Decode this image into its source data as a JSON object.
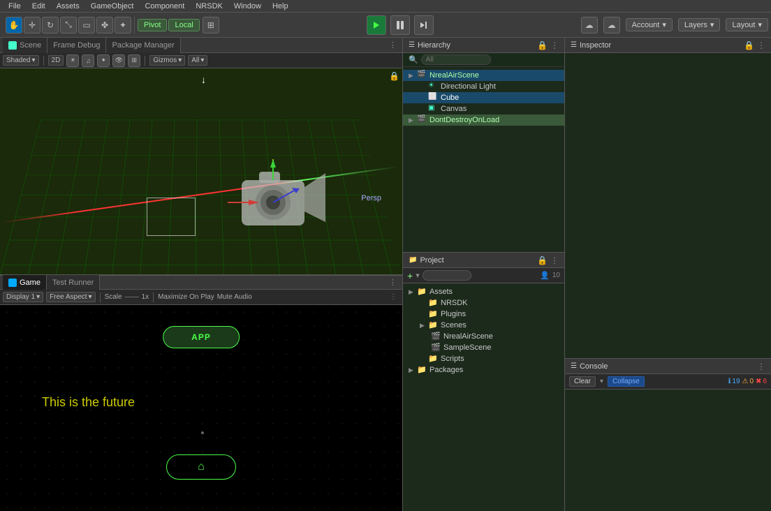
{
  "menubar": {
    "items": [
      "File",
      "Edit",
      "Assets",
      "GameObject",
      "Component",
      "NRSDK",
      "Window",
      "Help"
    ]
  },
  "toolbar": {
    "pivot_label": "Pivot",
    "local_label": "Local",
    "account_label": "Account",
    "layers_label": "Layers",
    "layout_label": "Layout"
  },
  "scene_tab": {
    "label": "Scene",
    "other_tabs": [
      "Frame Debug",
      "Package Manager"
    ],
    "shading_mode": "Shaded",
    "dim_mode": "2D",
    "gizmos_label": "Gizmos",
    "all_label": "All",
    "persp_label": "Persp"
  },
  "game_tab": {
    "label": "Game",
    "other_tabs": [
      "Test Runner"
    ],
    "display_label": "Display 1",
    "aspect_label": "Free Aspect",
    "scale_label": "Scale",
    "scale_value": "1x",
    "maximize_label": "Maximize On Play",
    "mute_label": "Mute Audio",
    "app_button_label": "APP",
    "game_text": "This is the future",
    "home_icon": "⌂"
  },
  "hierarchy": {
    "title": "Hierarchy",
    "search_placeholder": "All",
    "items": [
      {
        "label": "NrealAirScene",
        "level": 0,
        "type": "scene",
        "expanded": true,
        "selected": true
      },
      {
        "label": "Directional Light",
        "level": 1,
        "type": "light"
      },
      {
        "label": "Cube",
        "level": 1,
        "type": "cube",
        "selected": true
      },
      {
        "label": "Canvas",
        "level": 1,
        "type": "canvas"
      },
      {
        "label": "DontDestroyOnLoad",
        "level": 0,
        "type": "scene",
        "highlighted": true
      }
    ]
  },
  "project": {
    "title": "Project",
    "search_placeholder": "",
    "items": [
      {
        "label": "Assets",
        "level": 0,
        "expanded": true
      },
      {
        "label": "NRSDK",
        "level": 1
      },
      {
        "label": "Plugins",
        "level": 1
      },
      {
        "label": "Scenes",
        "level": 1,
        "expanded": true
      },
      {
        "label": "NrealAirScene",
        "level": 2
      },
      {
        "label": "SampleScene",
        "level": 2
      },
      {
        "label": "Scripts",
        "level": 1
      },
      {
        "label": "Packages",
        "level": 0
      }
    ],
    "count": "10"
  },
  "inspector": {
    "title": "Inspector"
  },
  "console": {
    "title": "Console",
    "clear_label": "Clear",
    "collapse_label": "Collapse",
    "info_count": "19",
    "warn_count": "0",
    "error_count": "6"
  }
}
